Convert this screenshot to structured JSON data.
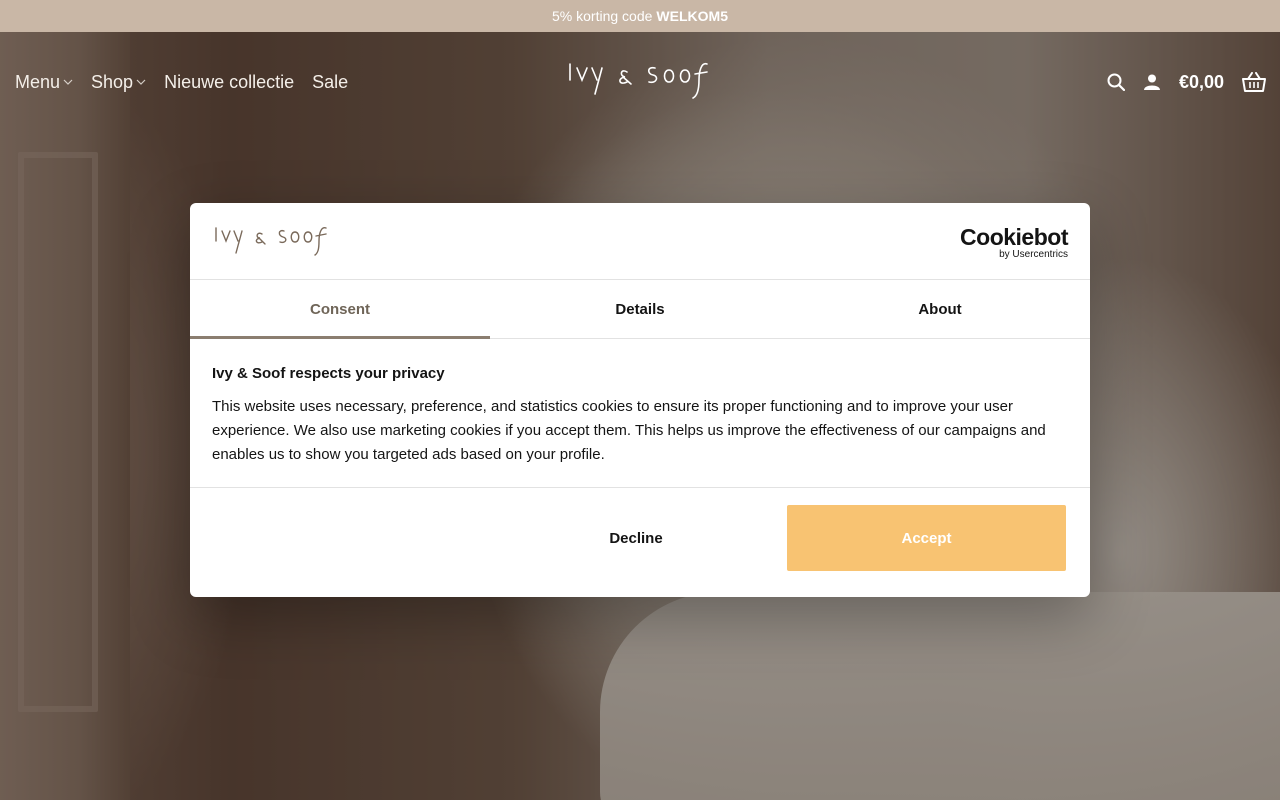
{
  "promo": {
    "text": "5% korting code",
    "code": "WELKOM5"
  },
  "header": {
    "nav": [
      {
        "label": "Menu",
        "has_dropdown": true
      },
      {
        "label": "Shop",
        "has_dropdown": true
      },
      {
        "label": "Nieuwe collectie",
        "has_dropdown": false
      },
      {
        "label": "Sale",
        "has_dropdown": false
      }
    ],
    "logo_text": "Ivy & Soof",
    "cart_total": "€0,00",
    "icons": [
      "search-icon",
      "account-icon",
      "basket-icon"
    ]
  },
  "modal": {
    "logo_text": "Ivy & Soof",
    "provider_name": "Cookiebot",
    "provider_by": "by Usercentrics",
    "tabs": [
      {
        "label": "Consent",
        "active": true
      },
      {
        "label": "Details",
        "active": false
      },
      {
        "label": "About",
        "active": false
      }
    ],
    "title": "Ivy & Soof respects your privacy",
    "text": "This website uses necessary, preference, and statistics cookies to ensure its proper functioning and to improve your user experience. We also use marketing cookies if you accept them. This helps us improve the effectiveness of our campaigns and enables us to show you targeted ads based on your profile.",
    "decline_label": "Decline",
    "accept_label": "Accept"
  },
  "colors": {
    "promo_bar": "#c9b7a6",
    "accept_button": "#f8c372",
    "active_tab": "#6f6558"
  }
}
